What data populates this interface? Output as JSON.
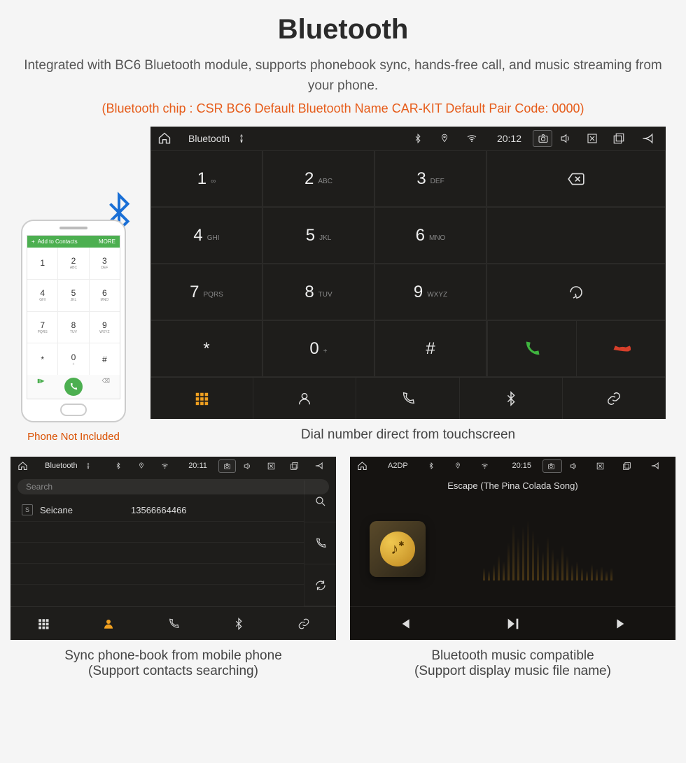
{
  "header": {
    "title": "Bluetooth",
    "subtitle": "Integrated with BC6 Bluetooth module, supports phonebook sync, hands-free call, and music streaming from your phone.",
    "spec_line": "(Bluetooth chip : CSR BC6    Default Bluetooth Name CAR-KIT    Default Pair Code: 0000)"
  },
  "phone_mockup": {
    "topbar_label": "Add to Contacts",
    "topbar_more": "MORE",
    "keys": [
      {
        "n": "1",
        "s": ""
      },
      {
        "n": "2",
        "s": "ABC"
      },
      {
        "n": "3",
        "s": "DEF"
      },
      {
        "n": "4",
        "s": "GHI"
      },
      {
        "n": "5",
        "s": "JKL"
      },
      {
        "n": "6",
        "s": "MNO"
      },
      {
        "n": "7",
        "s": "PQRS"
      },
      {
        "n": "8",
        "s": "TUV"
      },
      {
        "n": "9",
        "s": "WXYZ"
      },
      {
        "n": "*",
        "s": ""
      },
      {
        "n": "0",
        "s": "+"
      },
      {
        "n": "#",
        "s": ""
      }
    ],
    "caption": "Phone Not Included"
  },
  "main_device": {
    "statusbar": {
      "app_name": "Bluetooth",
      "time": "20:12"
    },
    "keys": [
      {
        "n": "1",
        "s": "∞"
      },
      {
        "n": "2",
        "s": "ABC"
      },
      {
        "n": "3",
        "s": "DEF"
      },
      {
        "n": "4",
        "s": "GHI"
      },
      {
        "n": "5",
        "s": "JKL"
      },
      {
        "n": "6",
        "s": "MNO"
      },
      {
        "n": "7",
        "s": "PQRS"
      },
      {
        "n": "8",
        "s": "TUV"
      },
      {
        "n": "9",
        "s": "WXYZ"
      },
      {
        "n": "*",
        "s": ""
      },
      {
        "n": "0",
        "s": "+"
      },
      {
        "n": "#",
        "s": ""
      }
    ],
    "caption": "Dial number direct from touchscreen"
  },
  "contacts_device": {
    "statusbar": {
      "app_name": "Bluetooth",
      "time": "20:11"
    },
    "search_placeholder": "Search",
    "contacts": [
      {
        "badge": "S",
        "name": "Seicane",
        "number": "13566664466"
      }
    ],
    "caption_line1": "Sync phone-book from mobile phone",
    "caption_line2": "(Support contacts searching)"
  },
  "music_device": {
    "statusbar": {
      "app_name": "A2DP",
      "time": "20:15"
    },
    "track_title": "Escape (The Pina Colada Song)",
    "caption_line1": "Bluetooth music compatible",
    "caption_line2": "(Support display music file name)"
  }
}
